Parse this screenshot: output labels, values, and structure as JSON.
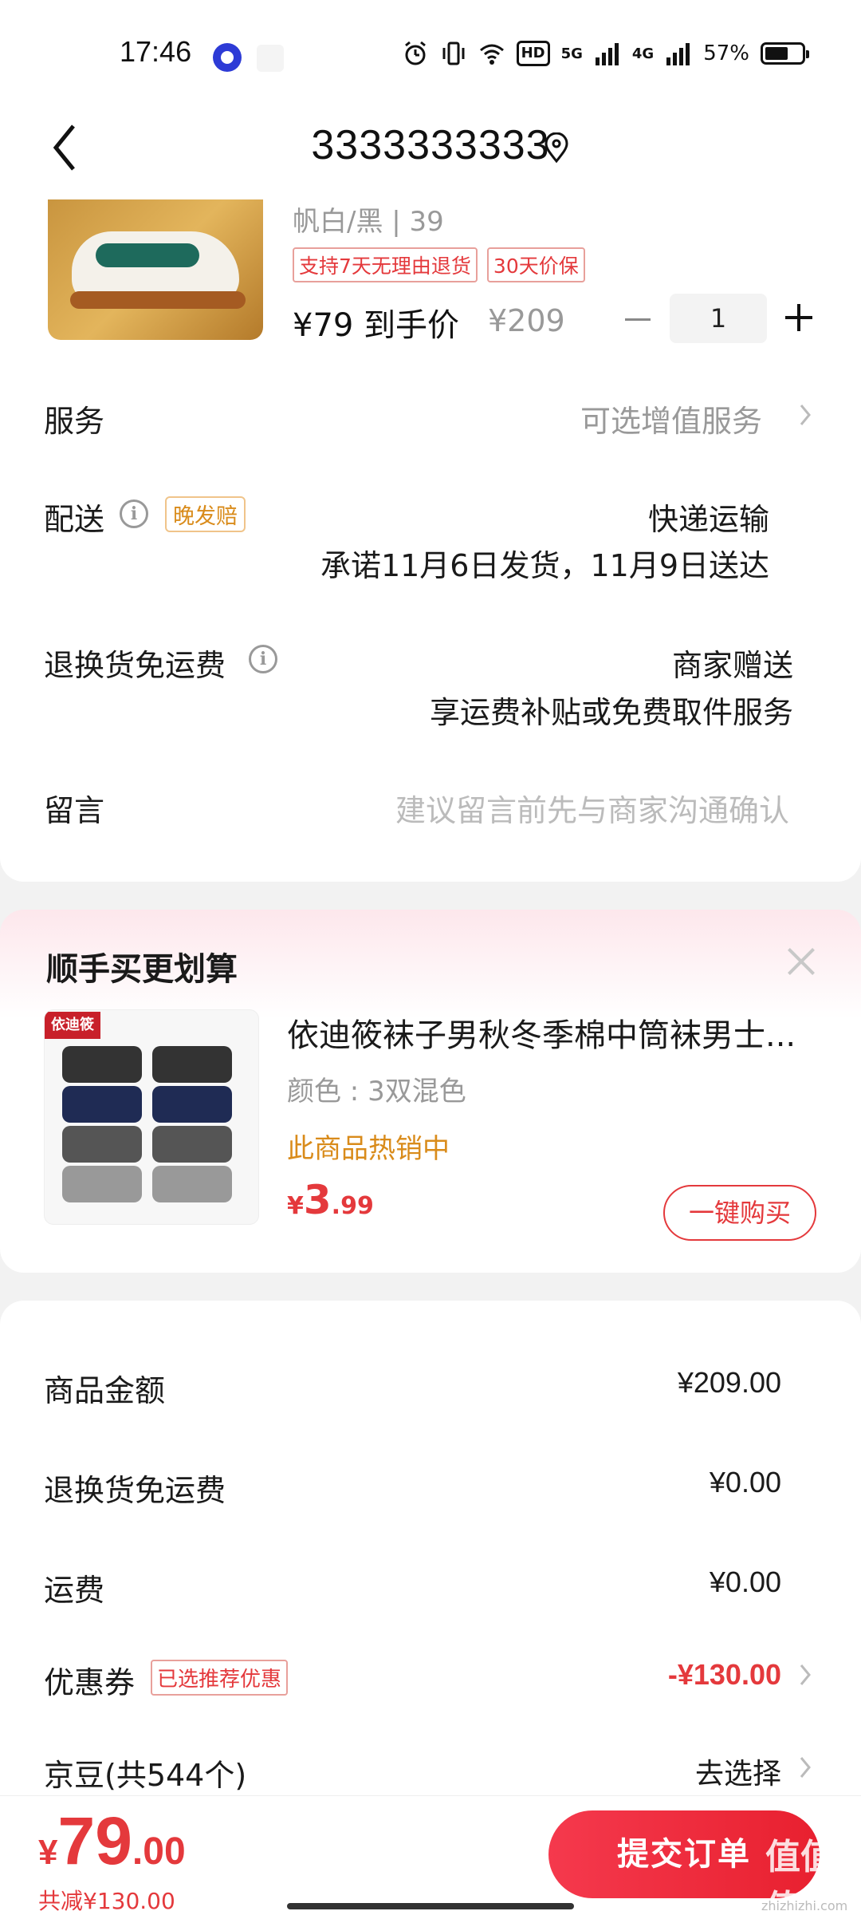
{
  "status_bar": {
    "time": "17:46",
    "network_1": "5G",
    "network_2": "4G",
    "hd_label": "HD",
    "battery": "57%"
  },
  "header": {
    "title": "3333333333",
    "back_icon": "chevron-left-icon",
    "location_icon": "location-pin-icon"
  },
  "product": {
    "spec": "帆白/黑 | 39",
    "tags": [
      "支持7天无理由退货",
      "30天价保"
    ],
    "price_label": "¥79 到手价",
    "original_price": "¥209",
    "quantity": "1"
  },
  "service": {
    "label": "服务",
    "value": "可选增值服务"
  },
  "delivery": {
    "label": "配送",
    "tag": "晚发赔",
    "method": "快递运输",
    "promise": "承诺11月6日发货，11月9日送达"
  },
  "return_shipping": {
    "label": "退换货免运费",
    "value_1": "商家赠送",
    "value_2": "享运费补贴或免费取件服务"
  },
  "message": {
    "label": "留言",
    "placeholder": "建议留言前先与商家沟通确认"
  },
  "recommend": {
    "title": "顺手买更划算",
    "logo_text": "依迪筱",
    "name": "依迪筱袜子男秋冬季棉中筒袜男士...",
    "color": "颜色 : 3双混色",
    "hot": "此商品热销中",
    "price_currency": "¥",
    "price_int": "3",
    "price_dec": ".99",
    "buy_label": "一键购买"
  },
  "summary": {
    "rows": [
      {
        "label": "商品金额",
        "value": "¥209.00"
      },
      {
        "label": "退换货免运费",
        "value": "¥0.00"
      },
      {
        "label": "运费",
        "value": "¥0.00"
      },
      {
        "label": "优惠券",
        "tag": "已选推荐优惠",
        "value": "-¥130.00"
      },
      {
        "label": "京豆(共544个)",
        "value": "去选择"
      }
    ]
  },
  "bottom": {
    "currency": "¥",
    "price_int": "79",
    "price_dec": ".00",
    "saved": "共减¥130.00",
    "submit_label": "提交订单",
    "watermark": "值值值",
    "watermark_sub": "zhizhizhi.com"
  },
  "colors": {
    "accent_red": "#e4393c",
    "orange": "#d98b1a"
  }
}
